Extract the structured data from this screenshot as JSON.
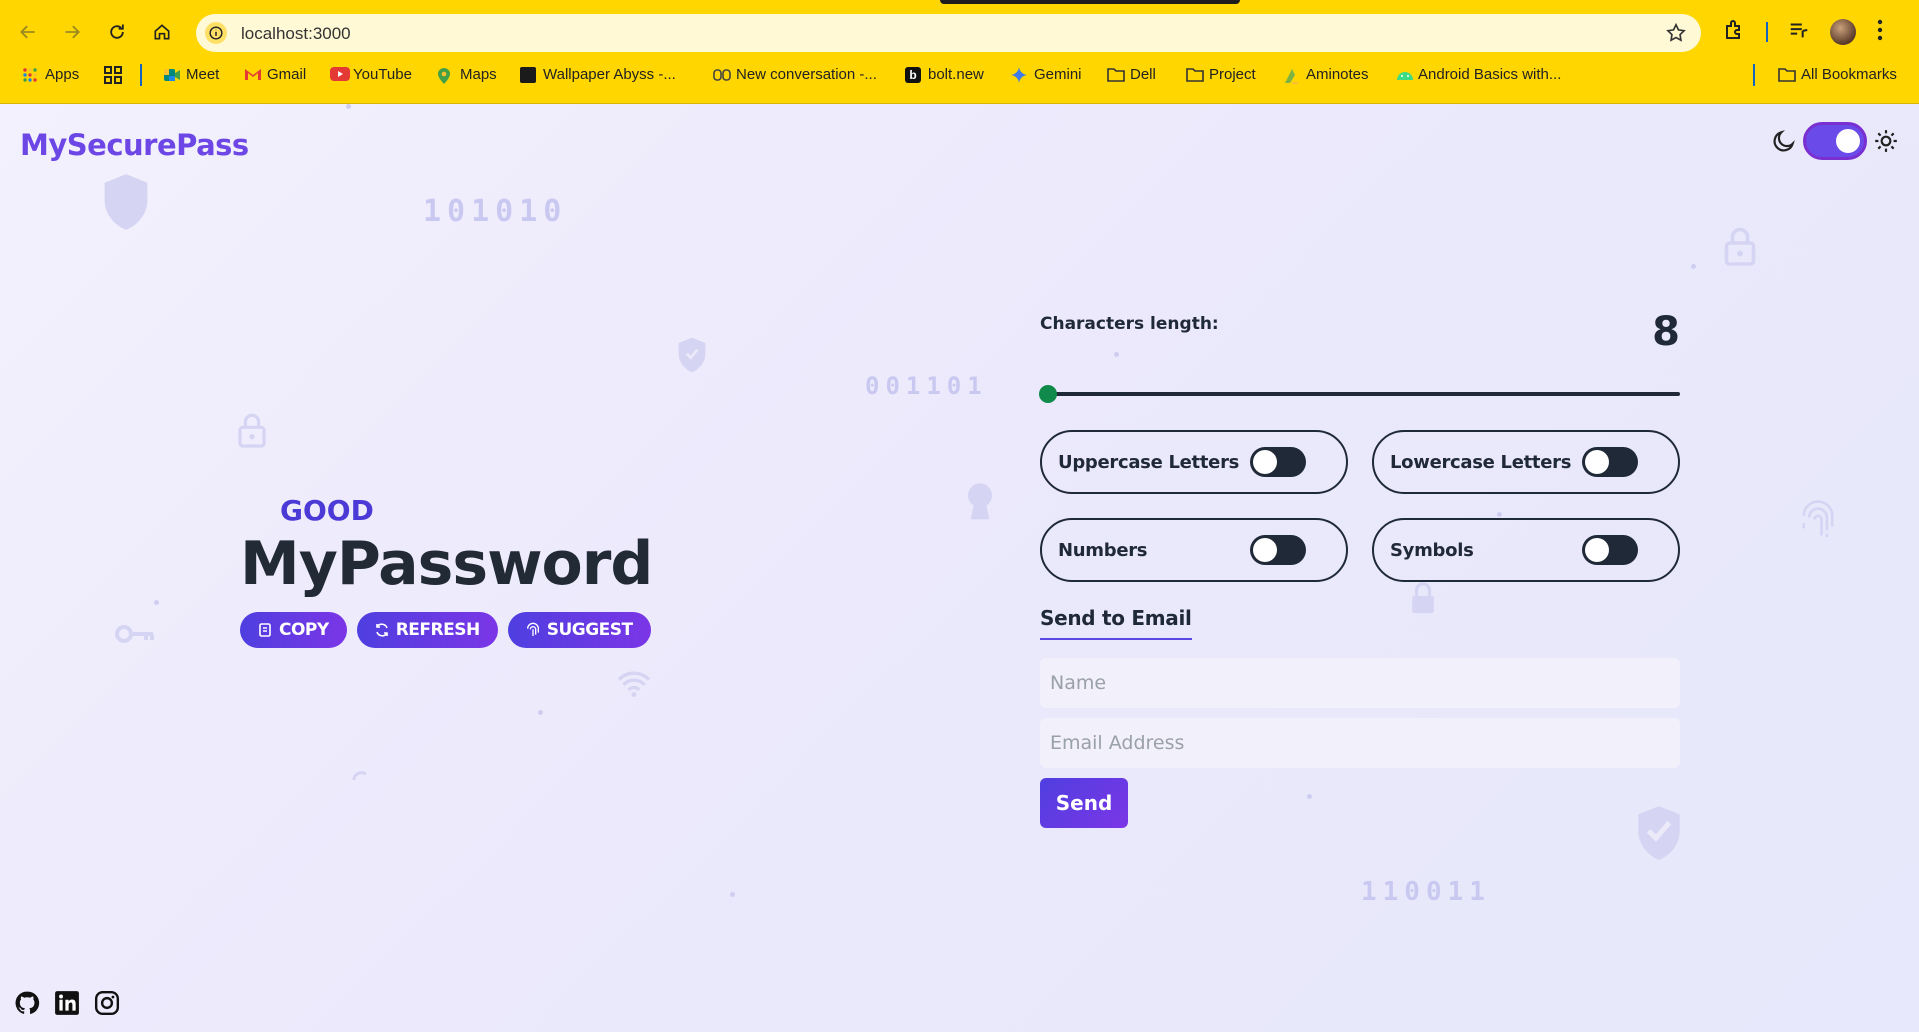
{
  "browser": {
    "url": "localhost:3000",
    "bookmarks": [
      {
        "label": "Apps",
        "icon": "apps-grid-icon"
      },
      {
        "label": "",
        "icon": "qr-grid-icon"
      },
      {
        "label": "Meet",
        "icon": "meet-icon"
      },
      {
        "label": "Gmail",
        "icon": "gmail-icon"
      },
      {
        "label": "YouTube",
        "icon": "youtube-icon"
      },
      {
        "label": "Maps",
        "icon": "maps-pin-icon"
      },
      {
        "label": "Wallpaper Abyss -...",
        "icon": "wallpaper-icon"
      },
      {
        "label": "New conversation -...",
        "icon": "copilot-icon"
      },
      {
        "label": "bolt.new",
        "icon": "bolt-icon"
      },
      {
        "label": "Gemini",
        "icon": "gemini-sparkle-icon"
      },
      {
        "label": "Dell",
        "icon": "folder-icon"
      },
      {
        "label": "Project",
        "icon": "folder-icon"
      },
      {
        "label": "Aminotes",
        "icon": "aminotes-icon"
      },
      {
        "label": "Android Basics with...",
        "icon": "android-icon"
      }
    ],
    "all_bookmarks": "All Bookmarks"
  },
  "app": {
    "brand": "MySecurePass",
    "theme": {
      "dark_mode_enabled": true
    },
    "background_codes": [
      "101010",
      "001101",
      "110011"
    ]
  },
  "generator": {
    "strength": "GOOD",
    "password": "MyPassword",
    "buttons": {
      "copy": "COPY",
      "refresh": "REFRESH",
      "suggest": "SUGGEST"
    }
  },
  "settings": {
    "length_label": "Characters length:",
    "length_value": "8",
    "length_slider_fraction": 0,
    "options": {
      "uppercase": {
        "label": "Uppercase Letters",
        "enabled": false
      },
      "lowercase": {
        "label": "Lowercase Letters",
        "enabled": false
      },
      "numbers": {
        "label": "Numbers",
        "enabled": false
      },
      "symbols": {
        "label": "Symbols",
        "enabled": false
      }
    }
  },
  "email": {
    "title": "Send to Email",
    "name_placeholder": "Name",
    "email_placeholder": "Email Address",
    "send_label": "Send"
  },
  "colors": {
    "browser_frame": "#ffd600",
    "brand": "#6d46e6",
    "accent": "#5b48e2",
    "slider_thumb": "#0f8a4a",
    "text_dark": "#1f2937"
  }
}
